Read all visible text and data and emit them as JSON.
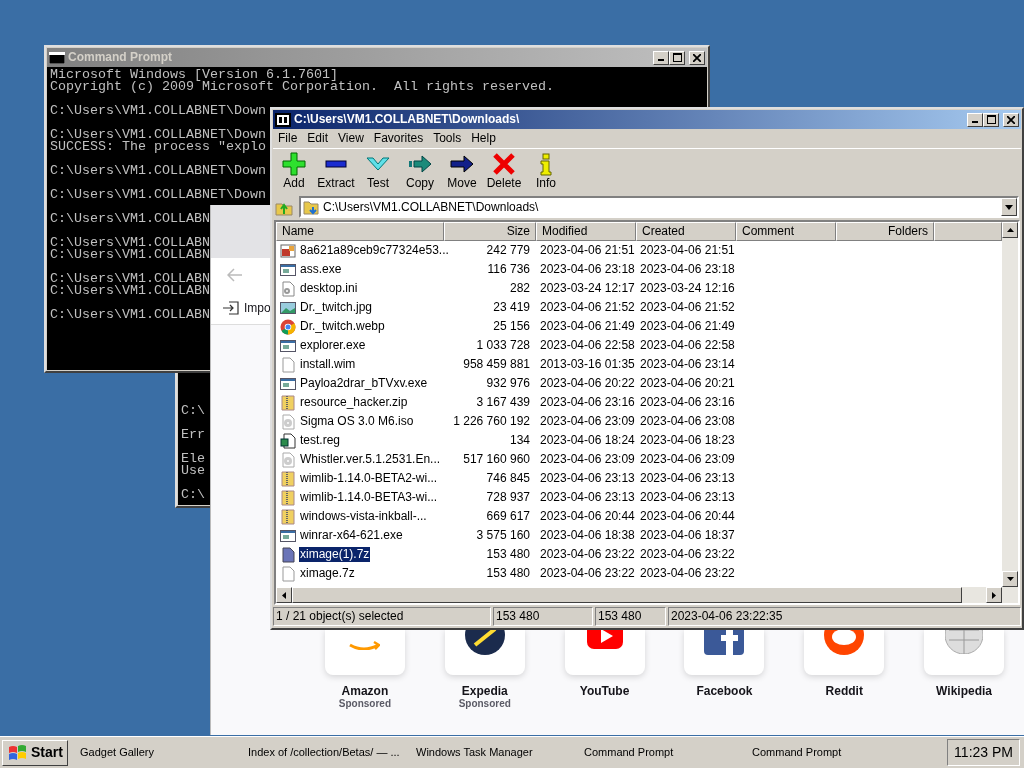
{
  "console_back": {
    "blocks": [
      [
        "C:\\"
      ],
      [
        "Err"
      ],
      [
        "Ele",
        "Use"
      ],
      [
        "C:\\"
      ]
    ]
  },
  "console_front": {
    "title": "Command Prompt",
    "active": false,
    "blocks": [
      [
        "Microsoft Windows [Version 6.1.7601]",
        "Copyright (c) 2009 Microsoft Corporation.  All rights reserved."
      ],
      [
        "C:\\Users\\VM1.COLLABNET\\Down"
      ],
      [
        "C:\\Users\\VM1.COLLABNET\\Down",
        "SUCCESS: The process \"explo"
      ],
      [
        "C:\\Users\\VM1.COLLABNET\\Down"
      ],
      [
        "C:\\Users\\VM1.COLLABNET\\Down"
      ],
      [
        "C:\\Users\\VM1.COLLABN"
      ],
      [
        "C:\\Users\\VM1.COLLABN",
        "C:\\Users\\VM1.COLLABN"
      ],
      [
        "C:\\Users\\VM1.COLLABN",
        "C:\\Users\\VM1.COLLABN"
      ],
      [
        "C:\\Users\\VM1.COLLABN"
      ]
    ]
  },
  "browser": {
    "bookmark": "Impo",
    "shortcuts": [
      {
        "title": "Amazon",
        "sponsored": "Sponsored"
      },
      {
        "title": "Expedia",
        "sponsored": "Sponsored"
      },
      {
        "title": "YouTube"
      },
      {
        "title": "Facebook"
      },
      {
        "title": "Reddit"
      },
      {
        "title": "Wikipedia"
      }
    ]
  },
  "archiver": {
    "title": "C:\\Users\\VM1.COLLABNET\\Downloads\\",
    "active": true,
    "menu": [
      "File",
      "Edit",
      "View",
      "Favorites",
      "Tools",
      "Help"
    ],
    "toolbar": [
      "Add",
      "Extract",
      "Test",
      "Copy",
      "Move",
      "Delete",
      "Info"
    ],
    "address": "C:\\Users\\VM1.COLLABNET\\Downloads\\",
    "columns": [
      "Name",
      "Size",
      "Modified",
      "Created",
      "Comment",
      "Folders"
    ],
    "rows": [
      {
        "kind": "bitmap",
        "name": "8a621a89ceb9c77324e53...",
        "size": "242 779",
        "modified": "2023-04-06 21:51",
        "created": "2023-04-06 21:51",
        "selected": false
      },
      {
        "kind": "program",
        "name": "ass.exe",
        "size": "116 736",
        "modified": "2023-04-06 23:18",
        "created": "2023-04-06 23:18",
        "selected": false
      },
      {
        "kind": "settings",
        "name": "desktop.ini",
        "size": "282",
        "modified": "2023-03-24 12:17",
        "created": "2023-03-24 12:16",
        "selected": false
      },
      {
        "kind": "photo",
        "name": "Dr._twitch.jpg",
        "size": "23 419",
        "modified": "2023-04-06 21:52",
        "created": "2023-04-06 21:52",
        "selected": false
      },
      {
        "kind": "browser",
        "name": "Dr._twitch.webp",
        "size": "25 156",
        "modified": "2023-04-06 21:49",
        "created": "2023-04-06 21:49",
        "selected": false
      },
      {
        "kind": "program",
        "name": "explorer.exe",
        "size": "1 033 728",
        "modified": "2023-04-06 22:58",
        "created": "2023-04-06 22:58",
        "selected": false
      },
      {
        "kind": "blank",
        "name": "install.wim",
        "size": "958 459 881",
        "modified": "2013-03-16 01:35",
        "created": "2023-04-06 23:14",
        "selected": false
      },
      {
        "kind": "program",
        "name": "Payloa2drar_bTVxv.exe",
        "size": "932 976",
        "modified": "2023-04-06 20:22",
        "created": "2023-04-06 20:21",
        "selected": false
      },
      {
        "kind": "zip",
        "name": "resource_hacker.zip",
        "size": "3 167 439",
        "modified": "2023-04-06 23:16",
        "created": "2023-04-06 23:16",
        "selected": false
      },
      {
        "kind": "disc",
        "name": "Sigma OS 3.0 M6.iso",
        "size": "1 226 760 192",
        "modified": "2023-04-06 23:09",
        "created": "2023-04-06 23:08",
        "selected": false
      },
      {
        "kind": "registry",
        "name": "test.reg",
        "size": "134",
        "modified": "2023-04-06 18:24",
        "created": "2023-04-06 18:23",
        "selected": false
      },
      {
        "kind": "disc",
        "name": "Whistler.ver.5.1.2531.En...",
        "size": "517 160 960",
        "modified": "2023-04-06 23:09",
        "created": "2023-04-06 23:09",
        "selected": false
      },
      {
        "kind": "zip",
        "name": "wimlib-1.14.0-BETA2-wi...",
        "size": "746 845",
        "modified": "2023-04-06 23:13",
        "created": "2023-04-06 23:13",
        "selected": false
      },
      {
        "kind": "zip",
        "name": "wimlib-1.14.0-BETA3-wi...",
        "size": "728 937",
        "modified": "2023-04-06 23:13",
        "created": "2023-04-06 23:13",
        "selected": false
      },
      {
        "kind": "zip",
        "name": "windows-vista-inkball-...",
        "size": "669 617",
        "modified": "2023-04-06 20:44",
        "created": "2023-04-06 20:44",
        "selected": false
      },
      {
        "kind": "program",
        "name": "winrar-x64-621.exe",
        "size": "3 575 160",
        "modified": "2023-04-06 18:38",
        "created": "2023-04-06 18:37",
        "selected": false
      },
      {
        "kind": "archive",
        "name": "ximage(1).7z",
        "size": "153 480",
        "modified": "2023-04-06 23:22",
        "created": "2023-04-06 23:22",
        "selected": true
      },
      {
        "kind": "blank",
        "name": "ximage.7z",
        "size": "153 480",
        "modified": "2023-04-06 23:22",
        "created": "2023-04-06 23:22",
        "selected": false
      }
    ],
    "status": [
      "1 / 21 object(s) selected",
      "153 480",
      "153 480",
      "2023-04-06 23:22:35"
    ]
  },
  "taskbar": {
    "start": "Start",
    "items": [
      "Gadget Gallery",
      "Index of /collection/Betas/ — ...",
      "Windows Task Manager",
      "Command Prompt",
      "Command Prompt"
    ],
    "clock": "11:23 PM"
  }
}
